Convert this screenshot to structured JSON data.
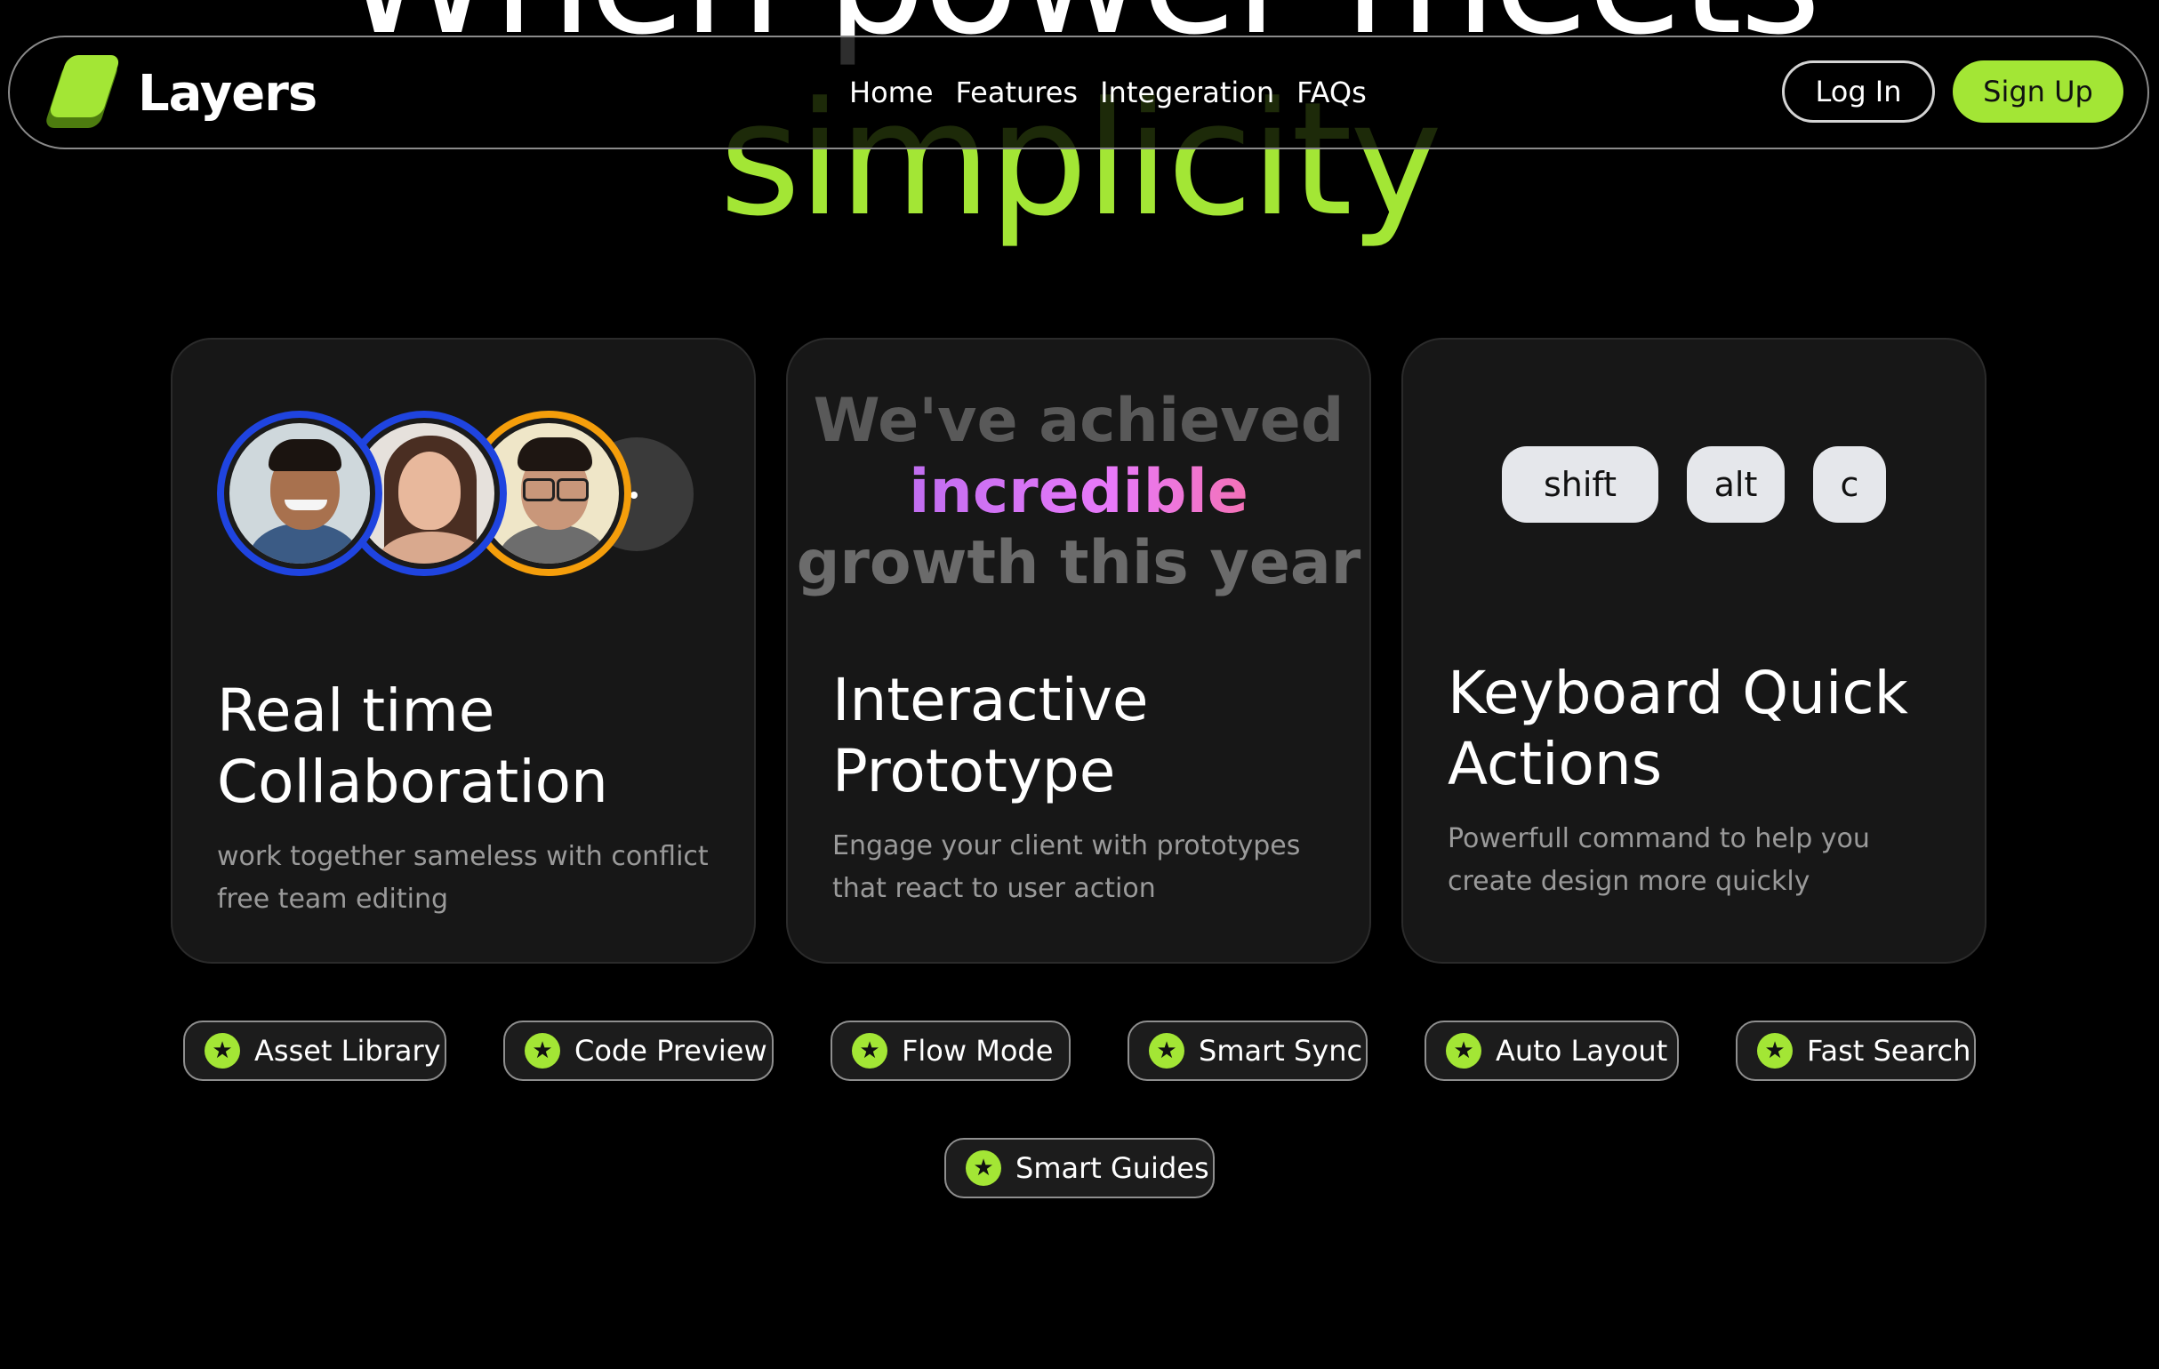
{
  "hero": {
    "line1": "When power meets",
    "line2": "simplicity"
  },
  "nav": {
    "brand": "Layers",
    "links": [
      "Home",
      "Features",
      "Integeration",
      "FAQs"
    ],
    "login_label": "Log In",
    "signup_label": "Sign Up"
  },
  "cards": [
    {
      "title": "Real time Collaboration",
      "description": "work together sameless with conflict free team editing"
    },
    {
      "growth": [
        "We've achieved",
        "incredible",
        "growth this year"
      ],
      "title": "Interactive Prototype",
      "description": "Engage your client with prototypes that react to user action"
    },
    {
      "keys": [
        "shift",
        "alt",
        "c"
      ],
      "title": "Keyboard Quick Actions",
      "description": "Powerfull command to help you create design more quickly"
    }
  ],
  "tags": [
    "Asset Library",
    "Code Preview",
    "Flow Mode",
    "Smart Sync",
    "Auto Layout",
    "Fast Search",
    "Smart Guides"
  ],
  "colors": {
    "accent": "#a3e635",
    "card_bg": "#171717",
    "avatar_ring_blue": "#1f44e0",
    "avatar_ring_orange": "#f59e0b"
  },
  "icons": {
    "tag_icon": "star-icon",
    "more_icon": "ellipsis-icon"
  }
}
